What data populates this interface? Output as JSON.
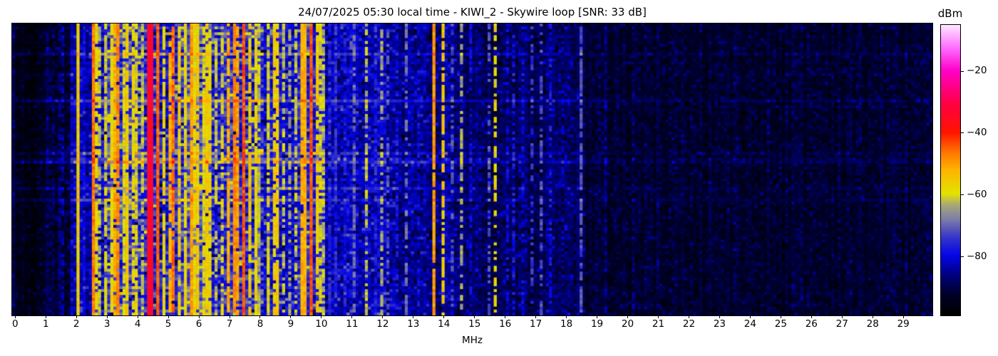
{
  "chart_data": {
    "type": "heatmap",
    "title": "24/07/2025 05:30 local time - KIWI_2 - Skywire loop [SNR: 33 dB]",
    "xlabel": "MHz",
    "x_axis": {
      "min": -0.1,
      "max": 29.95,
      "ticks": [
        0,
        1,
        2,
        3,
        4,
        5,
        6,
        7,
        8,
        9,
        10,
        11,
        12,
        13,
        14,
        15,
        16,
        17,
        18,
        19,
        20,
        21,
        22,
        23,
        24,
        25,
        26,
        27,
        28,
        29
      ]
    },
    "y_axis": {
      "description": "time (waterfall rows, no labels)",
      "rows": 100
    },
    "colorbar": {
      "label": "dBm",
      "ticks": [
        -20,
        -40,
        -60,
        -80
      ],
      "value_range": [
        -99,
        -5
      ],
      "colormap_stops": [
        [
          0.0,
          "#000000"
        ],
        [
          0.07,
          "#000028"
        ],
        [
          0.14,
          "#000080"
        ],
        [
          0.206,
          "#0505e8"
        ],
        [
          0.27,
          "#3838c8"
        ],
        [
          0.33,
          "#7d7da8"
        ],
        [
          0.38,
          "#a8a878"
        ],
        [
          0.419,
          "#e3e300"
        ],
        [
          0.5,
          "#ffb400"
        ],
        [
          0.56,
          "#ff7800"
        ],
        [
          0.63,
          "#ff1400"
        ],
        [
          0.73,
          "#ff0045"
        ],
        [
          0.843,
          "#ff00c8"
        ],
        [
          0.92,
          "#ff6aff"
        ],
        [
          1.0,
          "#ffe6ff"
        ]
      ]
    },
    "grid": {
      "cols": 300,
      "rows": 100
    },
    "noise_seed": 42,
    "spectrum_bands": [
      {
        "from": 0.0,
        "to": 1.05,
        "base": -95,
        "speckle": 4,
        "streak": 0.5
      },
      {
        "from": 1.05,
        "to": 1.78,
        "base": -91,
        "speckle": 5,
        "streak": 0.6
      },
      {
        "from": 1.78,
        "to": 2.55,
        "base": -83,
        "speckle": 6,
        "streak": 0.8
      },
      {
        "from": 2.55,
        "to": 3.05,
        "base": -79,
        "speckle": 9,
        "streak": 1.0
      },
      {
        "from": 3.05,
        "to": 4.2,
        "base": -73,
        "speckle": 11,
        "streak": 1.0
      },
      {
        "from": 4.2,
        "to": 5.3,
        "base": -77,
        "speckle": 10,
        "streak": 1.0
      },
      {
        "from": 5.3,
        "to": 6.4,
        "base": -72,
        "speckle": 11,
        "streak": 1.0
      },
      {
        "from": 6.4,
        "to": 7.6,
        "base": -76,
        "speckle": 10,
        "streak": 1.0
      },
      {
        "from": 7.6,
        "to": 8.1,
        "base": -75,
        "speckle": 10,
        "streak": 1.0
      },
      {
        "from": 8.1,
        "to": 9.2,
        "base": -80,
        "speckle": 8,
        "streak": 0.8
      },
      {
        "from": 9.2,
        "to": 10.1,
        "base": -77,
        "speckle": 9,
        "streak": 0.8
      },
      {
        "from": 10.1,
        "to": 12.1,
        "base": -82,
        "speckle": 7,
        "streak": 0.6
      },
      {
        "from": 12.1,
        "to": 14.6,
        "base": -85,
        "speckle": 6,
        "streak": 0.5
      },
      {
        "from": 14.6,
        "to": 18.6,
        "base": -88,
        "speckle": 5,
        "streak": 0.35
      },
      {
        "from": 18.6,
        "to": 30.0,
        "base": -92,
        "speckle": 4,
        "streak": 0.25
      }
    ],
    "carriers": [
      {
        "mhz": 1.45,
        "dbm": -86,
        "w": 1,
        "duty": 0.5
      },
      {
        "mhz": 1.55,
        "dbm": -84,
        "w": 1,
        "duty": 0.6
      },
      {
        "mhz": 2.0,
        "dbm": -56,
        "w": 1,
        "duty": 1.0
      },
      {
        "mhz": 2.17,
        "dbm": -80,
        "w": 1,
        "duty": 0.6
      },
      {
        "mhz": 2.5,
        "dbm": -47,
        "w": 1,
        "duty": 1.0
      },
      {
        "mhz": 2.58,
        "dbm": -58,
        "w": 1,
        "duty": 0.8
      },
      {
        "mhz": 2.72,
        "dbm": -62,
        "w": 1,
        "duty": 0.7
      },
      {
        "mhz": 2.9,
        "dbm": -60,
        "w": 1,
        "duty": 0.8
      },
      {
        "mhz": 3.1,
        "dbm": -58,
        "w": 1,
        "duty": 0.9
      },
      {
        "mhz": 3.22,
        "dbm": -52,
        "w": 1,
        "duty": 0.9
      },
      {
        "mhz": 3.33,
        "dbm": -48,
        "w": 1,
        "duty": 0.85
      },
      {
        "mhz": 3.48,
        "dbm": -60,
        "w": 1,
        "duty": 0.8
      },
      {
        "mhz": 3.64,
        "dbm": -56,
        "w": 1,
        "duty": 0.9
      },
      {
        "mhz": 3.8,
        "dbm": -58,
        "w": 1,
        "duty": 0.8
      },
      {
        "mhz": 3.95,
        "dbm": -60,
        "w": 1,
        "duty": 0.8
      },
      {
        "mhz": 4.1,
        "dbm": -62,
        "w": 1,
        "duty": 0.7
      },
      {
        "mhz": 4.3,
        "dbm": -34,
        "w": 2,
        "duty": 1.0
      },
      {
        "mhz": 4.42,
        "dbm": -40,
        "w": 1,
        "duty": 0.9
      },
      {
        "mhz": 4.62,
        "dbm": -45,
        "w": 1,
        "duty": 1.0
      },
      {
        "mhz": 4.8,
        "dbm": -58,
        "w": 1,
        "duty": 0.8
      },
      {
        "mhz": 5.0,
        "dbm": -52,
        "w": 1,
        "duty": 0.85
      },
      {
        "mhz": 5.15,
        "dbm": -46,
        "w": 1,
        "duty": 0.9
      },
      {
        "mhz": 5.35,
        "dbm": -56,
        "w": 1,
        "duty": 0.8
      },
      {
        "mhz": 5.55,
        "dbm": -58,
        "w": 1,
        "duty": 0.9
      },
      {
        "mhz": 5.73,
        "dbm": -50,
        "w": 1,
        "duty": 0.95
      },
      {
        "mhz": 5.85,
        "dbm": -58,
        "w": 1,
        "duty": 0.9
      },
      {
        "mhz": 5.95,
        "dbm": -56,
        "w": 1,
        "duty": 0.9
      },
      {
        "mhz": 6.07,
        "dbm": -60,
        "w": 1,
        "duty": 0.85
      },
      {
        "mhz": 6.18,
        "dbm": -56,
        "w": 1,
        "duty": 0.9
      },
      {
        "mhz": 6.3,
        "dbm": -58,
        "w": 1,
        "duty": 0.85
      },
      {
        "mhz": 6.55,
        "dbm": -62,
        "w": 1,
        "duty": 0.6
      },
      {
        "mhz": 6.75,
        "dbm": -60,
        "w": 1,
        "duty": 0.7
      },
      {
        "mhz": 6.89,
        "dbm": -52,
        "w": 1,
        "duty": 0.8
      },
      {
        "mhz": 7.12,
        "dbm": -48,
        "w": 1,
        "duty": 0.95
      },
      {
        "mhz": 7.25,
        "dbm": -50,
        "w": 1,
        "duty": 0.9
      },
      {
        "mhz": 7.43,
        "dbm": -44,
        "w": 1,
        "duty": 1.0
      },
      {
        "mhz": 7.65,
        "dbm": -56,
        "w": 1,
        "duty": 0.9
      },
      {
        "mhz": 7.78,
        "dbm": -58,
        "w": 1,
        "duty": 0.85
      },
      {
        "mhz": 7.95,
        "dbm": -62,
        "w": 1,
        "duty": 0.7
      },
      {
        "mhz": 8.25,
        "dbm": -60,
        "w": 1,
        "duty": 0.8
      },
      {
        "mhz": 8.38,
        "dbm": -56,
        "w": 2,
        "duty": 0.85
      },
      {
        "mhz": 8.7,
        "dbm": -62,
        "w": 1,
        "duty": 0.7
      },
      {
        "mhz": 8.95,
        "dbm": -64,
        "w": 1,
        "duty": 0.6
      },
      {
        "mhz": 9.15,
        "dbm": -62,
        "w": 1,
        "duty": 0.7
      },
      {
        "mhz": 9.27,
        "dbm": -52,
        "w": 2,
        "duty": 0.95
      },
      {
        "mhz": 9.45,
        "dbm": -60,
        "w": 1,
        "duty": 0.8
      },
      {
        "mhz": 9.65,
        "dbm": -44,
        "w": 1,
        "duty": 1.0
      },
      {
        "mhz": 9.8,
        "dbm": -56,
        "w": 1,
        "duty": 0.85
      },
      {
        "mhz": 9.92,
        "dbm": -60,
        "w": 1,
        "duty": 0.8
      },
      {
        "mhz": 10.05,
        "dbm": -62,
        "w": 1,
        "duty": 0.7
      },
      {
        "mhz": 10.25,
        "dbm": -76,
        "w": 1,
        "duty": 0.6
      },
      {
        "mhz": 10.45,
        "dbm": -75,
        "w": 1,
        "duty": 0.6
      },
      {
        "mhz": 10.75,
        "dbm": -78,
        "w": 1,
        "duty": 0.5
      },
      {
        "mhz": 11.05,
        "dbm": -70,
        "w": 1,
        "duty": 0.6
      },
      {
        "mhz": 11.42,
        "dbm": -62,
        "w": 1,
        "duty": 0.6
      },
      {
        "mhz": 11.7,
        "dbm": -76,
        "w": 1,
        "duty": 0.5
      },
      {
        "mhz": 11.97,
        "dbm": -64,
        "w": 1,
        "duty": 0.6
      },
      {
        "mhz": 12.1,
        "dbm": -72,
        "w": 1,
        "duty": 0.5
      },
      {
        "mhz": 12.4,
        "dbm": -78,
        "w": 1,
        "duty": 0.5
      },
      {
        "mhz": 12.73,
        "dbm": -70,
        "w": 1,
        "duty": 0.5
      },
      {
        "mhz": 13.1,
        "dbm": -80,
        "w": 1,
        "duty": 0.5
      },
      {
        "mhz": 13.66,
        "dbm": -50,
        "w": 1,
        "duty": 0.95
      },
      {
        "mhz": 13.97,
        "dbm": -56,
        "w": 1,
        "duty": 0.7
      },
      {
        "mhz": 14.2,
        "dbm": -72,
        "w": 1,
        "duty": 0.5
      },
      {
        "mhz": 14.48,
        "dbm": -64,
        "w": 1,
        "duty": 0.55
      },
      {
        "mhz": 14.8,
        "dbm": -80,
        "w": 1,
        "duty": 0.5
      },
      {
        "mhz": 15.45,
        "dbm": -72,
        "w": 1,
        "duty": 0.5
      },
      {
        "mhz": 15.64,
        "dbm": -58,
        "w": 1,
        "duty": 0.6
      },
      {
        "mhz": 16.0,
        "dbm": -80,
        "w": 1,
        "duty": 0.5
      },
      {
        "mhz": 16.2,
        "dbm": -78,
        "w": 1,
        "duty": 0.5
      },
      {
        "mhz": 16.5,
        "dbm": -80,
        "w": 1,
        "duty": 0.4
      },
      {
        "mhz": 16.85,
        "dbm": -75,
        "w": 1,
        "duty": 0.5
      },
      {
        "mhz": 17.15,
        "dbm": -72,
        "w": 1,
        "duty": 0.55
      },
      {
        "mhz": 17.45,
        "dbm": -78,
        "w": 1,
        "duty": 0.5
      },
      {
        "mhz": 17.8,
        "dbm": -82,
        "w": 1,
        "duty": 0.4
      },
      {
        "mhz": 18.42,
        "dbm": -72,
        "w": 1,
        "duty": 0.7
      },
      {
        "mhz": 19.2,
        "dbm": -85,
        "w": 1,
        "duty": 0.5
      },
      {
        "mhz": 20.1,
        "dbm": -86,
        "w": 1,
        "duty": 0.4
      },
      {
        "mhz": 21.3,
        "dbm": -88,
        "w": 1,
        "duty": 0.3
      }
    ]
  }
}
